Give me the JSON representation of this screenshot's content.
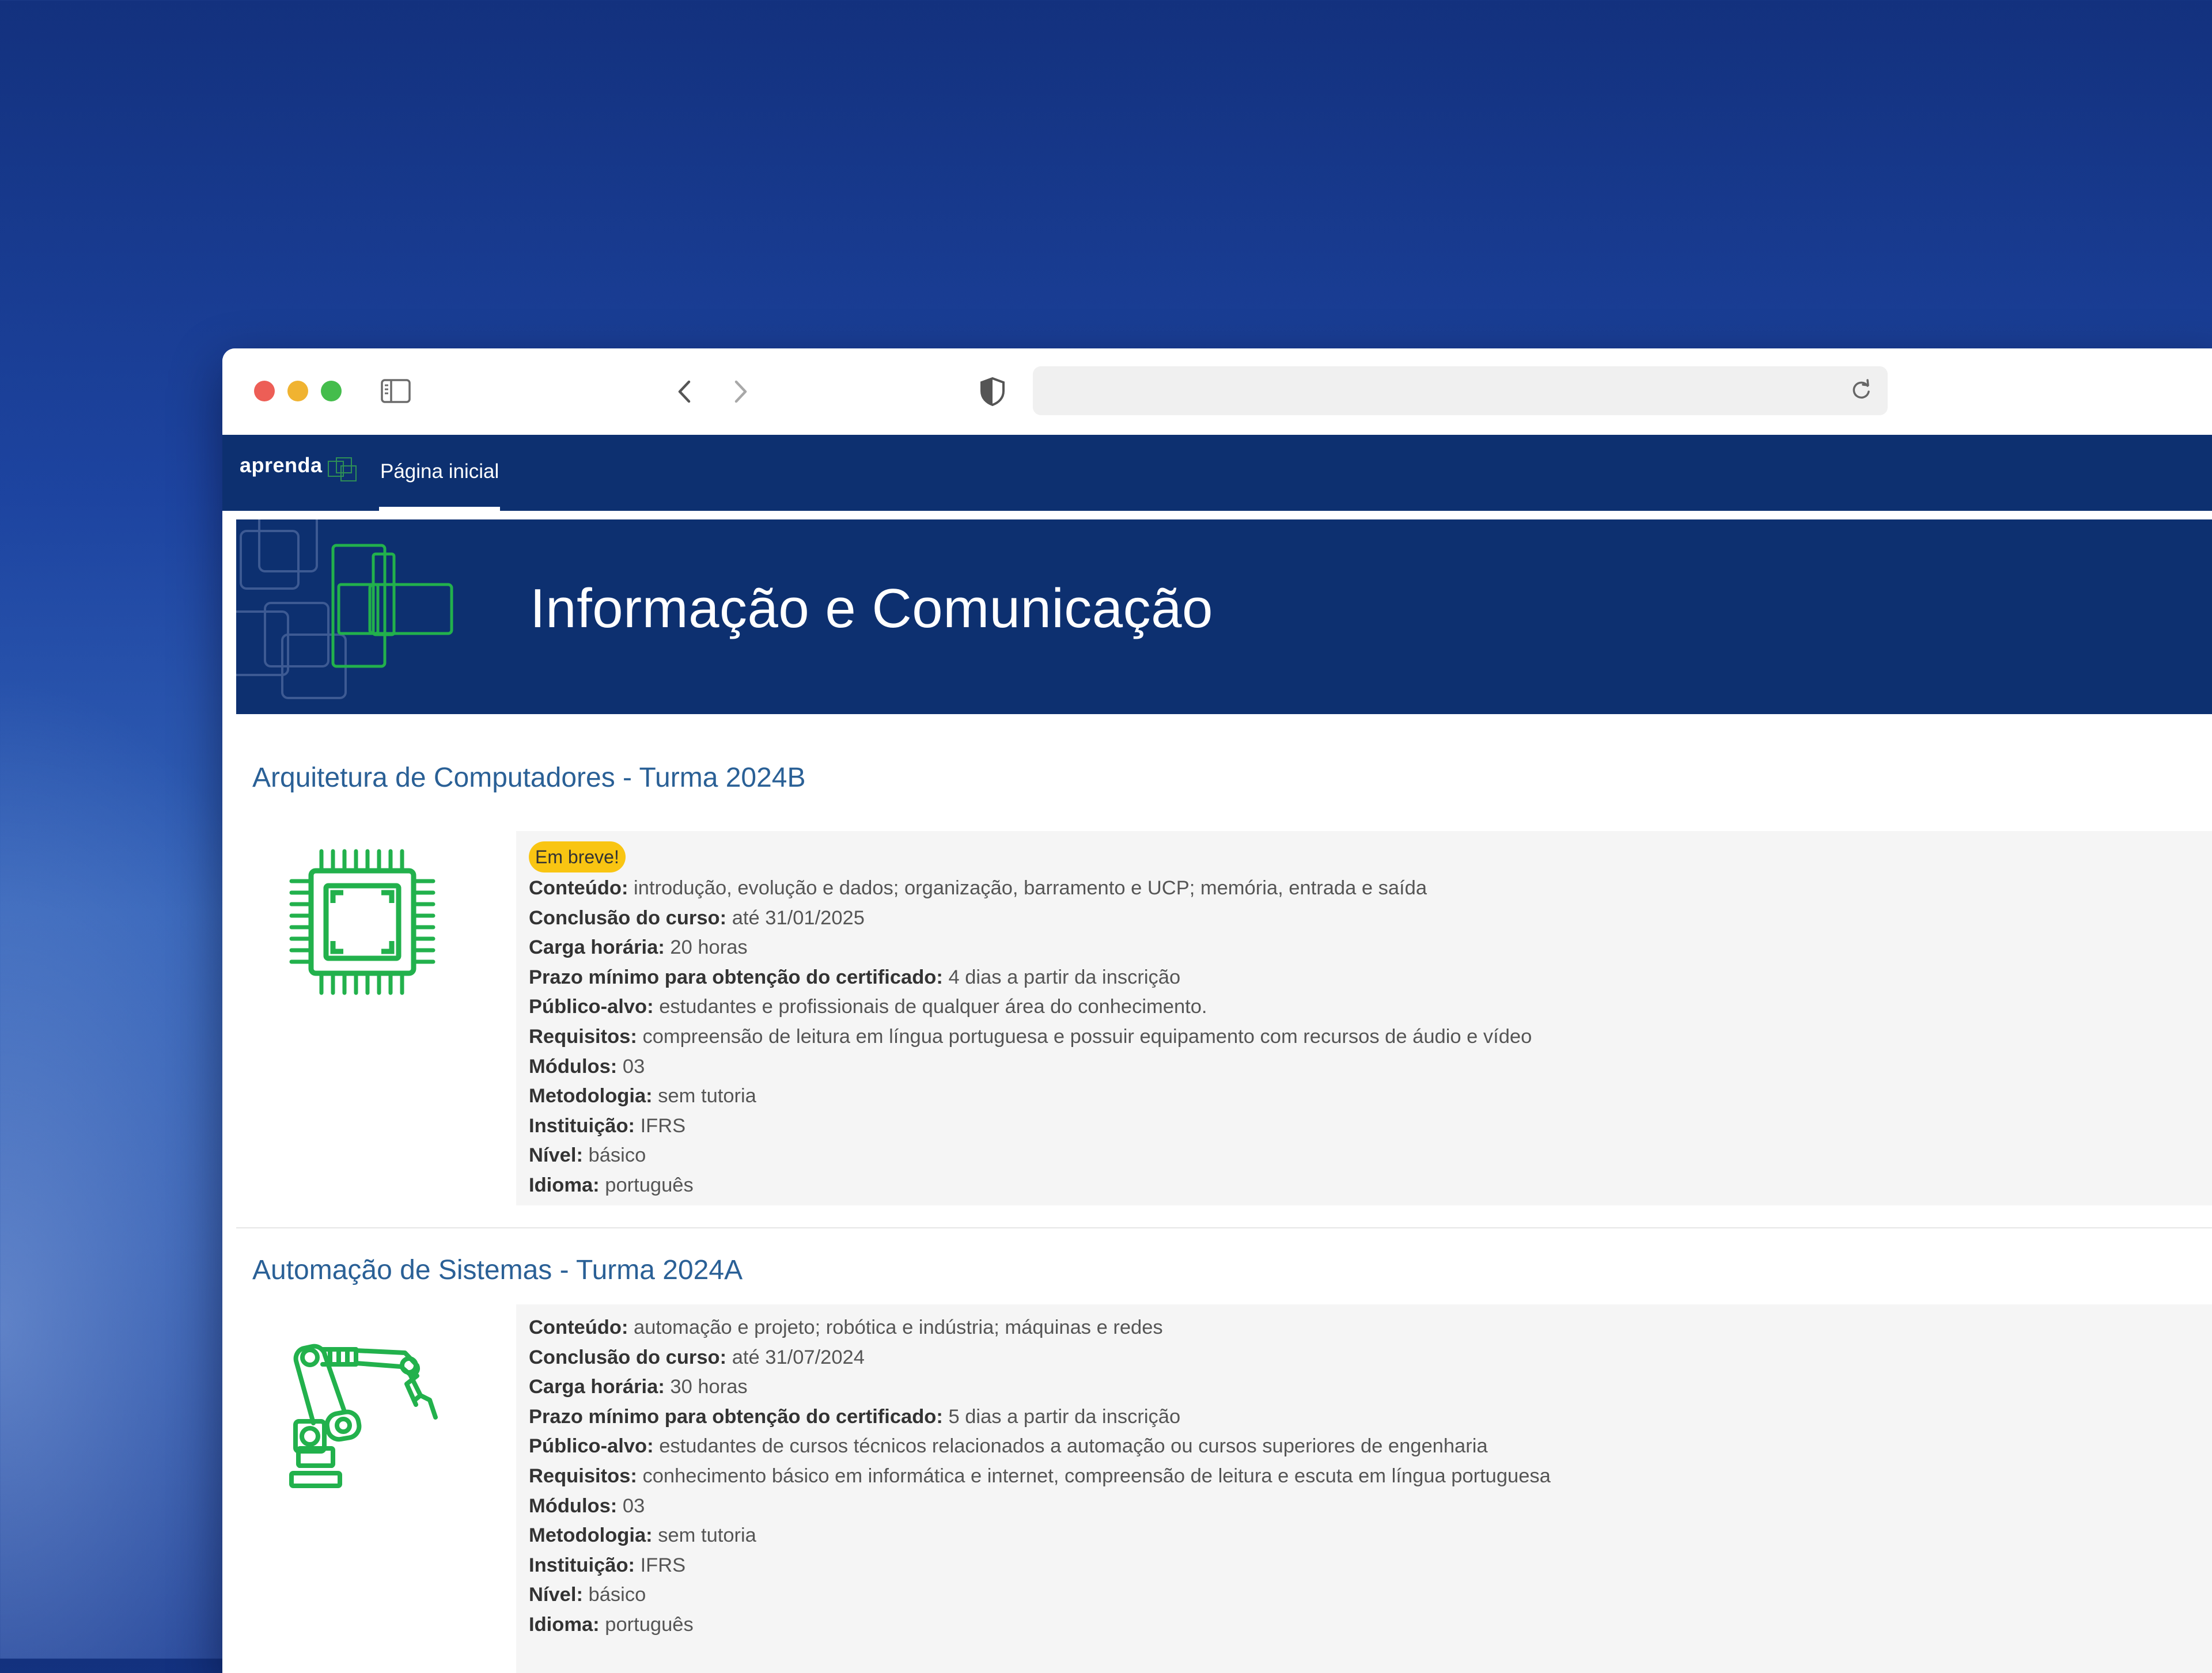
{
  "browser": {
    "url_text": ""
  },
  "nav": {
    "logo_text": "aprenda",
    "home_label": "Página inicial"
  },
  "banner": {
    "title": "Informação e Comunicação"
  },
  "colors": {
    "navy": "#0d3070",
    "link_blue": "#2a6096",
    "icon_green": "#22b14c",
    "badge_yellow": "#f9c512"
  },
  "courses": [
    {
      "title": "Arquitetura de Computadores - Turma 2024B",
      "icon": "cpu-chip-icon",
      "badge": "Em breve!",
      "fields": [
        {
          "label": "Conteúdo:",
          "value": " introdução, evolução e dados; organização, barramento e UCP; memória, entrada e saída"
        },
        {
          "label": "Conclusão do curso:",
          "value": " até 31/01/2025"
        },
        {
          "label": "Carga horária:",
          "value": " 20 horas"
        },
        {
          "label": "Prazo mínimo para obtenção do certificado:",
          "value": " 4 dias a partir da inscrição"
        },
        {
          "label": "Público-alvo:",
          "value": " estudantes e profissionais de qualquer área do conhecimento."
        },
        {
          "label": "Requisitos:",
          "value": " compreensão de leitura em língua portuguesa e possuir equipamento com recursos de áudio e vídeo"
        },
        {
          "label": "Módulos:",
          "value": " 03"
        },
        {
          "label": "Metodologia:",
          "value": " sem tutoria"
        },
        {
          "label": "Instituição:",
          "value": " IFRS"
        },
        {
          "label": "Nível:",
          "value": " básico"
        },
        {
          "label": "Idioma:",
          "value": " português"
        }
      ]
    },
    {
      "title": "Automação de Sistemas - Turma 2024A",
      "icon": "robot-arm-icon",
      "fields": [
        {
          "label": "Conteúdo:",
          "value": " automação e projeto; robótica e indústria; máquinas e redes"
        },
        {
          "label": "Conclusão do curso:",
          "value": " até 31/07/2024"
        },
        {
          "label": "Carga horária:",
          "value": " 30 horas"
        },
        {
          "label": "Prazo mínimo para obtenção do certificado:",
          "value": " 5 dias a partir da inscrição"
        },
        {
          "label": "Público-alvo:",
          "value": " estudantes de cursos técnicos relacionados a automação ou cursos superiores de engenharia"
        },
        {
          "label": "Requisitos:",
          "value": " conhecimento básico em informática e internet, compreensão de leitura e escuta em língua portuguesa"
        },
        {
          "label": "Módulos:",
          "value": " 03"
        },
        {
          "label": "Metodologia:",
          "value": " sem tutoria"
        },
        {
          "label": "Instituição:",
          "value": " IFRS"
        },
        {
          "label": "Nível:",
          "value": " básico"
        },
        {
          "label": "Idioma:",
          "value": " português"
        }
      ]
    }
  ]
}
